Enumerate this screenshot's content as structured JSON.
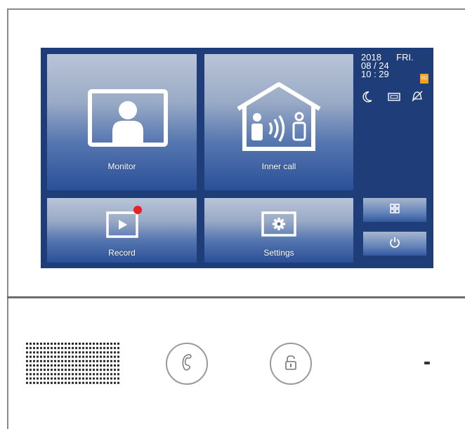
{
  "screen": {
    "tiles": {
      "monitor": {
        "label": "Monitor",
        "icon": "monitor-person-icon"
      },
      "inner_call": {
        "label": "Inner call",
        "icon": "house-intercom-icon"
      },
      "record": {
        "label": "Record",
        "icon": "play-icon",
        "has_notification": true,
        "notification_color": "#e8202a"
      },
      "settings": {
        "label": "Settings",
        "icon": "gear-icon"
      }
    },
    "status": {
      "year": "2018",
      "weekday": "FRI.",
      "date": "08 / 24",
      "time": "10 : 29",
      "sd_label": "SD",
      "icons": [
        "moon-icon",
        "envelope-icon",
        "bell-muted-icon"
      ]
    },
    "side_buttons": [
      {
        "icon": "grid-icon"
      },
      {
        "icon": "power-icon"
      }
    ],
    "colors": {
      "screen_bg": "#1f3d78",
      "sd_badge": "#f0a21d"
    }
  },
  "hardware": {
    "buttons": [
      {
        "icon": "handset-icon"
      },
      {
        "icon": "unlock-icon"
      }
    ]
  }
}
